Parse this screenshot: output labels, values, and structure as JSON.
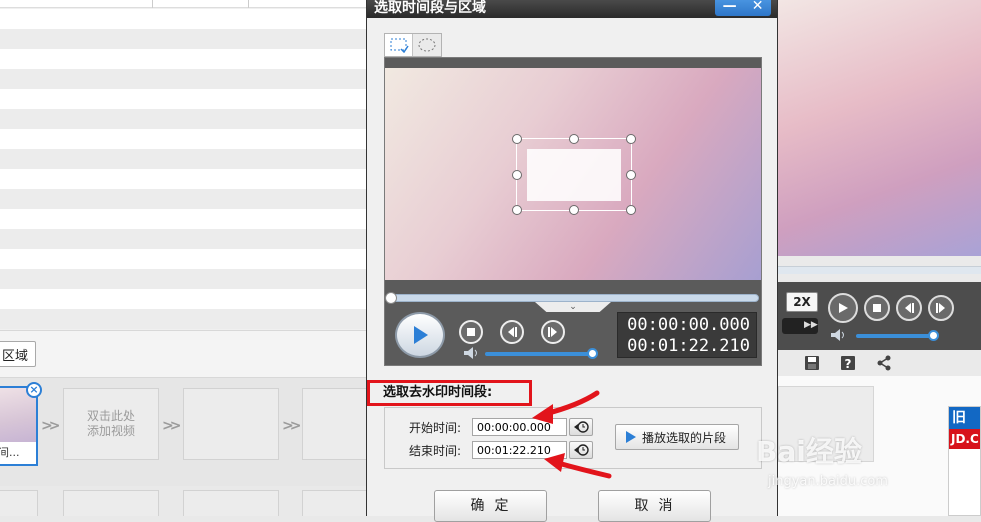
{
  "left_panel": {
    "region_button_label": "区域",
    "clip_caption": "间...",
    "add_video_hint_line1": "双击此处",
    "add_video_hint_line2": "添加视频"
  },
  "dialog": {
    "title": "选取时间段与区域",
    "timecode_current": "00:00:00.000",
    "timecode_total": "00:01:22.210",
    "section_label": "选取去水印时间段:",
    "start_label": "开始时间:",
    "start_value": "00:00:00.000",
    "end_label": "结束时间:",
    "end_value": "00:01:22.210",
    "play_segment_label": "播放选取的片段",
    "ok_label": "确定",
    "cancel_label": "取消",
    "volume_level_percent": 100,
    "seek_position_percent": 0
  },
  "right_panel": {
    "speed_label": "2X",
    "volume_level_percent": 90,
    "ad_top_text": "旧",
    "ad_mid_text": "JD.C"
  },
  "watermark": {
    "logo_text": "Bai经验",
    "sub_text": "jingyan.baidu.com"
  },
  "colors": {
    "accent_blue": "#3b8fd9",
    "highlight_red": "#e2141b",
    "title_bar_dark": "#2a2a2a",
    "window_button_blue": "#2e76c8"
  },
  "icons": [
    "rect-select-icon",
    "ellipse-select-icon",
    "play-icon",
    "stop-icon",
    "prev-frame-icon",
    "next-frame-icon",
    "volume-icon",
    "clock-icon",
    "minimize-icon",
    "close-icon",
    "save-icon",
    "help-icon",
    "share-icon"
  ]
}
